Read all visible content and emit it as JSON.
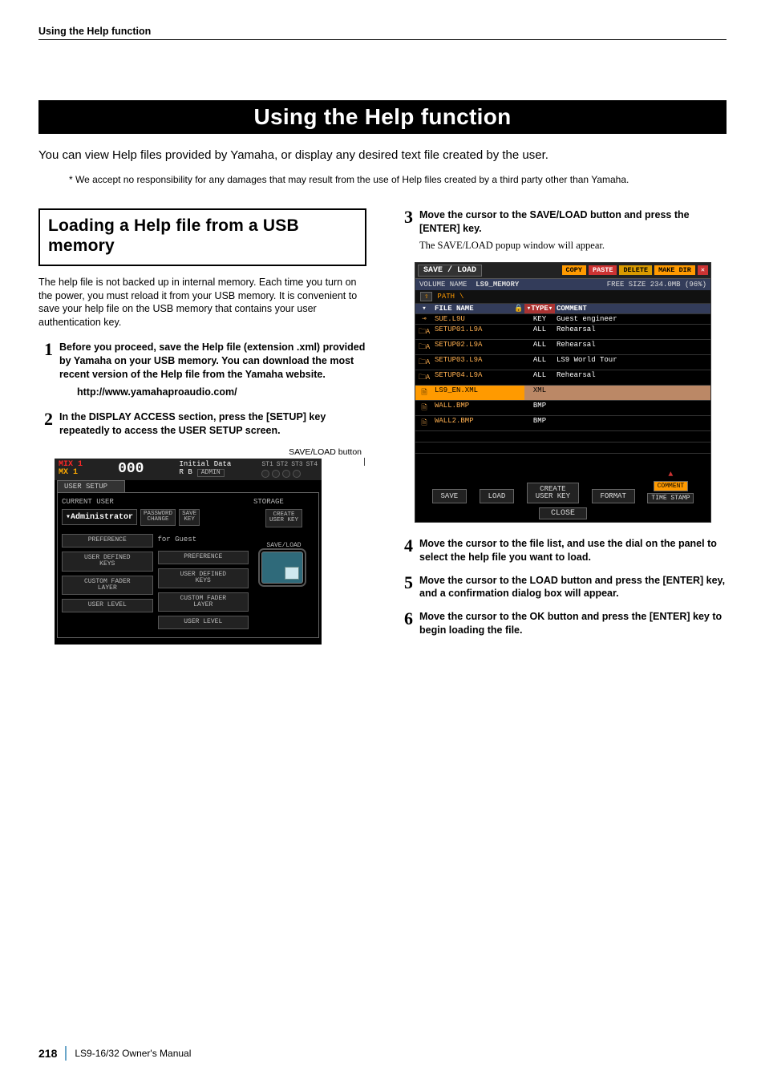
{
  "running_head": "Using the Help function",
  "page_title": "Using the Help function",
  "intro": "You can view Help files provided by Yamaha, or display any desired text file created by the user.",
  "disclaimer": "* We accept no responsibility for any damages that may result from the use of Help files created by a third party other than Yamaha.",
  "section_left_title": "Loading a Help file from a USB memory",
  "section_left_para": "The help file is not backed up in internal memory. Each time you turn on the power, you must reload it from your USB memory. It is convenient to save your help file on the USB memory that contains your user authentication key.",
  "steps_left": [
    {
      "num": "1",
      "text": "Before you proceed, save the Help file (extension .xml) provided by Yamaha on your USB memory. You can download the most recent version of the Help file from the Yamaha website."
    },
    {
      "num": "2",
      "text": "In the DISPLAY ACCESS section, press the [SETUP] key repeatedly to access the USER SETUP screen."
    }
  ],
  "url": "http://www.yamahaproaudio.com/",
  "fig1_label": "SAVE/LOAD button",
  "steps_right": [
    {
      "num": "3",
      "text": "Move the cursor to the SAVE/LOAD button and press the [ENTER] key.",
      "sub": "The SAVE/LOAD popup window will appear."
    },
    {
      "num": "4",
      "text": "Move the cursor to the file list, and use the dial on the panel to select the help file you want to load."
    },
    {
      "num": "5",
      "text": "Move the cursor to the LOAD button and press the [ENTER] key, and a confirmation dialog box will appear."
    },
    {
      "num": "6",
      "text": "Move the cursor to the OK button and press the [ENTER] key to begin loading the file."
    }
  ],
  "user_setup": {
    "mix": "MIX 1",
    "mx": "MX 1",
    "scene_num": "000",
    "initial": "Initial Data",
    "rb": "R B",
    "admin_label": "ADMIN",
    "st_labels": [
      "ST1",
      "ST2",
      "ST3",
      "ST4"
    ],
    "tab": "USER SETUP",
    "current_user_label": "CURRENT USER",
    "storage_label": "STORAGE",
    "administrator": "▾Administrator",
    "password_change": "PASSWORD\nCHANGE",
    "save_key": "SAVE\nKEY",
    "create_user_key": "CREATE\nUSER KEY",
    "for_guest": "for Guest",
    "buttons": [
      "PREFERENCE",
      "USER DEFINED\nKEYS",
      "CUSTOM FADER\nLAYER",
      "USER LEVEL"
    ],
    "saveload": "SAVE/LOAD"
  },
  "saveload": {
    "title": "SAVE / LOAD",
    "copy": "COPY",
    "paste": "PASTE",
    "delete": "DELETE",
    "makedir": "MAKE DIR",
    "vol_label": "VOLUME NAME",
    "vol_name": "LS9_MEMORY",
    "free": "FREE SIZE 234.0MB (96%)",
    "path_label": "PATH",
    "path": "\\",
    "headers": {
      "file": "FILE NAME",
      "type": "TYPE",
      "comment": "COMMENT"
    },
    "rows": [
      {
        "icon": "⊸",
        "name": "SUE.L9U",
        "lock": "",
        "type": "KEY",
        "comment": "Guest engineer"
      },
      {
        "icon": "🗀A",
        "name": "SETUP01.L9A",
        "lock": "",
        "type": "ALL",
        "comment": "Rehearsal"
      },
      {
        "icon": "🗀A",
        "name": "SETUP02.L9A",
        "lock": "",
        "type": "ALL",
        "comment": "Rehearsal"
      },
      {
        "icon": "🗀A",
        "name": "SETUP03.L9A",
        "lock": "",
        "type": "ALL",
        "comment": "LS9 World Tour"
      },
      {
        "icon": "🗀A",
        "name": "SETUP04.L9A",
        "lock": "",
        "type": "ALL",
        "comment": "Rehearsal"
      },
      {
        "icon": "🗎",
        "name": "LS9_EN.XML",
        "lock": "",
        "type": "XML",
        "comment": "",
        "selected": true
      },
      {
        "icon": "🗎",
        "name": "WALL.BMP",
        "lock": "",
        "type": "BMP",
        "comment": ""
      },
      {
        "icon": "🗎",
        "name": "WALL2.BMP",
        "lock": "",
        "type": "BMP",
        "comment": ""
      }
    ],
    "btn_save": "SAVE",
    "btn_load": "LOAD",
    "btn_create": "CREATE\nUSER KEY",
    "btn_format": "FORMAT",
    "tab_comment": "COMMENT",
    "tab_timestamp": "TIME STAMP",
    "btn_close": "CLOSE"
  },
  "footer": {
    "page": "218",
    "manual": "LS9-16/32  Owner's Manual"
  }
}
